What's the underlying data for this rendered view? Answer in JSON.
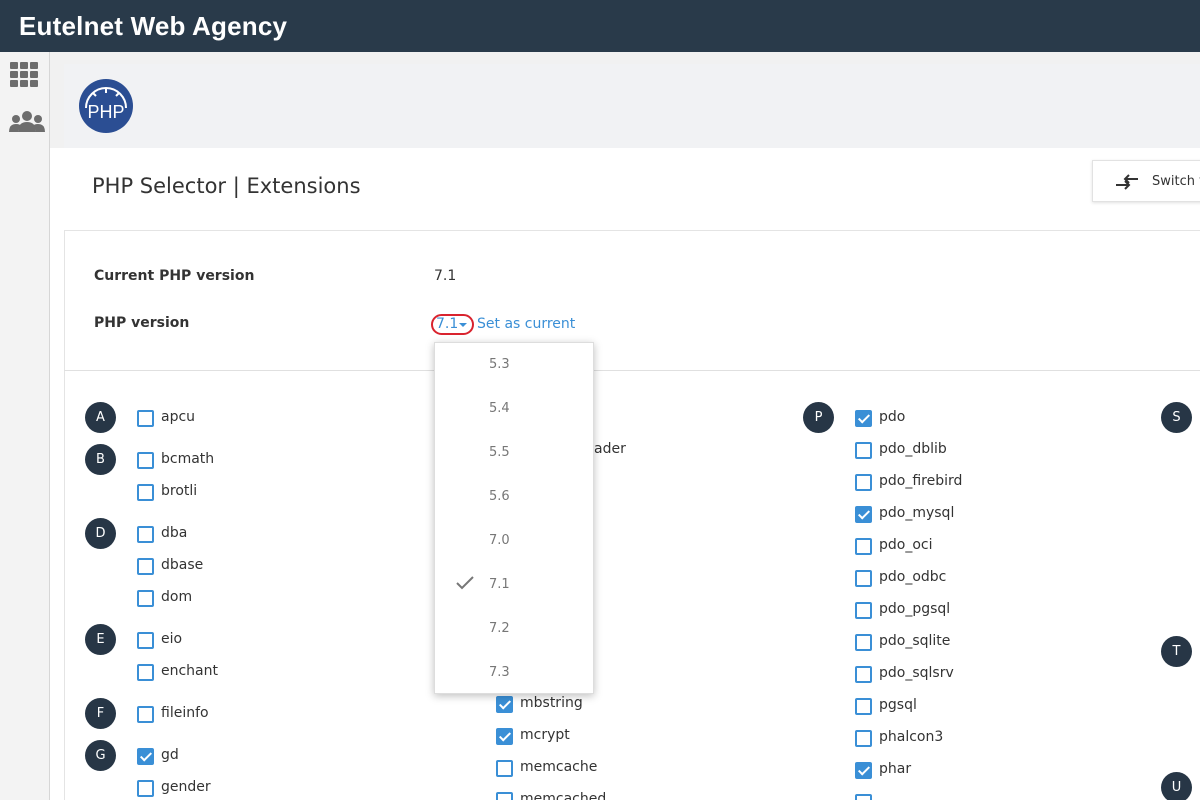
{
  "header": {
    "brand": "Eutelnet Web Agency"
  },
  "sidebar": {
    "items": [
      {
        "icon": "grid-icon"
      },
      {
        "icon": "users-icon"
      }
    ]
  },
  "logo": {
    "text": "PHP"
  },
  "page": {
    "title": "PHP Selector | Extensions"
  },
  "switch_button": {
    "label": "Switch t"
  },
  "info": {
    "current_label": "Current PHP version",
    "current_value": "7.1",
    "version_label": "PHP version",
    "selected_version": "7.1",
    "set_current": "Set as current"
  },
  "dropdown": {
    "options": [
      "5.3",
      "5.4",
      "5.5",
      "5.6",
      "7.0",
      "7.1",
      "7.2",
      "7.3"
    ],
    "selected": "7.1"
  },
  "letters": [
    "A",
    "B",
    "D",
    "E",
    "F",
    "G",
    "P",
    "S",
    "T",
    "U"
  ],
  "extensions": {
    "col1": [
      {
        "name": "apcu",
        "checked": false
      },
      {
        "name": "bcmath",
        "checked": false
      },
      {
        "name": "brotli",
        "checked": false
      },
      {
        "name": "dba",
        "checked": false
      },
      {
        "name": "dbase",
        "checked": false
      },
      {
        "name": "dom",
        "checked": false
      },
      {
        "name": "eio",
        "checked": false
      },
      {
        "name": "enchant",
        "checked": false
      },
      {
        "name": "fileinfo",
        "checked": false
      },
      {
        "name": "gd",
        "checked": true
      },
      {
        "name": "gender",
        "checked": false
      }
    ],
    "col2": [
      {
        "name": "ader",
        "checked": false
      },
      {
        "name": "mbstring",
        "checked": true
      },
      {
        "name": "mcrypt",
        "checked": true
      },
      {
        "name": "memcache",
        "checked": false
      },
      {
        "name": "memcached",
        "checked": false
      }
    ],
    "col3": [
      {
        "name": "pdo",
        "checked": true
      },
      {
        "name": "pdo_dblib",
        "checked": false
      },
      {
        "name": "pdo_firebird",
        "checked": false
      },
      {
        "name": "pdo_mysql",
        "checked": true
      },
      {
        "name": "pdo_oci",
        "checked": false
      },
      {
        "name": "pdo_odbc",
        "checked": false
      },
      {
        "name": "pdo_pgsql",
        "checked": false
      },
      {
        "name": "pdo_sqlite",
        "checked": false
      },
      {
        "name": "pdo_sqlsrv",
        "checked": false
      },
      {
        "name": "pgsql",
        "checked": false
      },
      {
        "name": "phalcon3",
        "checked": false
      },
      {
        "name": "phar",
        "checked": true
      }
    ]
  },
  "colors": {
    "header_bg": "#293a4a",
    "accent": "#3a8fd6",
    "letter_bg": "#273646",
    "highlight_ring": "#d9232e"
  }
}
